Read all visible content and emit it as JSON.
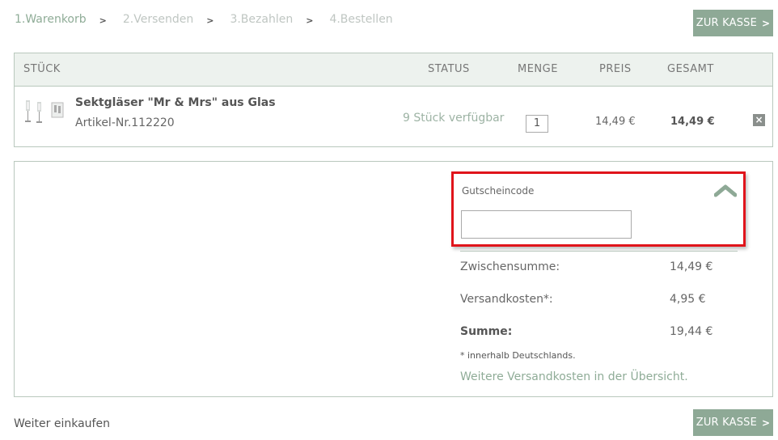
{
  "steps": [
    {
      "label": "1.Warenkorb"
    },
    {
      "label": "2.Versenden"
    },
    {
      "label": "3.Bezahlen"
    },
    {
      "label": "4.Bestellen"
    }
  ],
  "checkout_button": {
    "label": "ZUR KASSE"
  },
  "cart": {
    "headers": {
      "item": "STÜCK",
      "status": "STATUS",
      "quantity": "MENGE",
      "price": "PREIS",
      "total": "GESAMT"
    },
    "item": {
      "name": "Sektgläser \"Mr & Mrs\" aus Glas",
      "article_number": "Artikel-Nr.112220",
      "status": "9 Stück verfügbar",
      "quantity": "1",
      "price": "14,49 €",
      "total": "14,49 €"
    }
  },
  "coupon": {
    "label": "Gutscheincode",
    "value": "",
    "placeholder": ""
  },
  "summary": {
    "subtotal_label": "Zwischensumme:",
    "subtotal_value": "14,49 €",
    "shipping_label": "Versandkosten*:",
    "shipping_value": "4,95 €",
    "total_label": "Summe:",
    "total_value": "19,44 €",
    "note": "* innerhalb Deutschlands.",
    "shipping_link": "Weitere Versandkosten in der Übersicht."
  },
  "continue_shopping": "Weiter einkaufen",
  "colors": {
    "accent": "#8ea996",
    "highlight": "#e0141b",
    "header_bg": "#edf2ee"
  }
}
